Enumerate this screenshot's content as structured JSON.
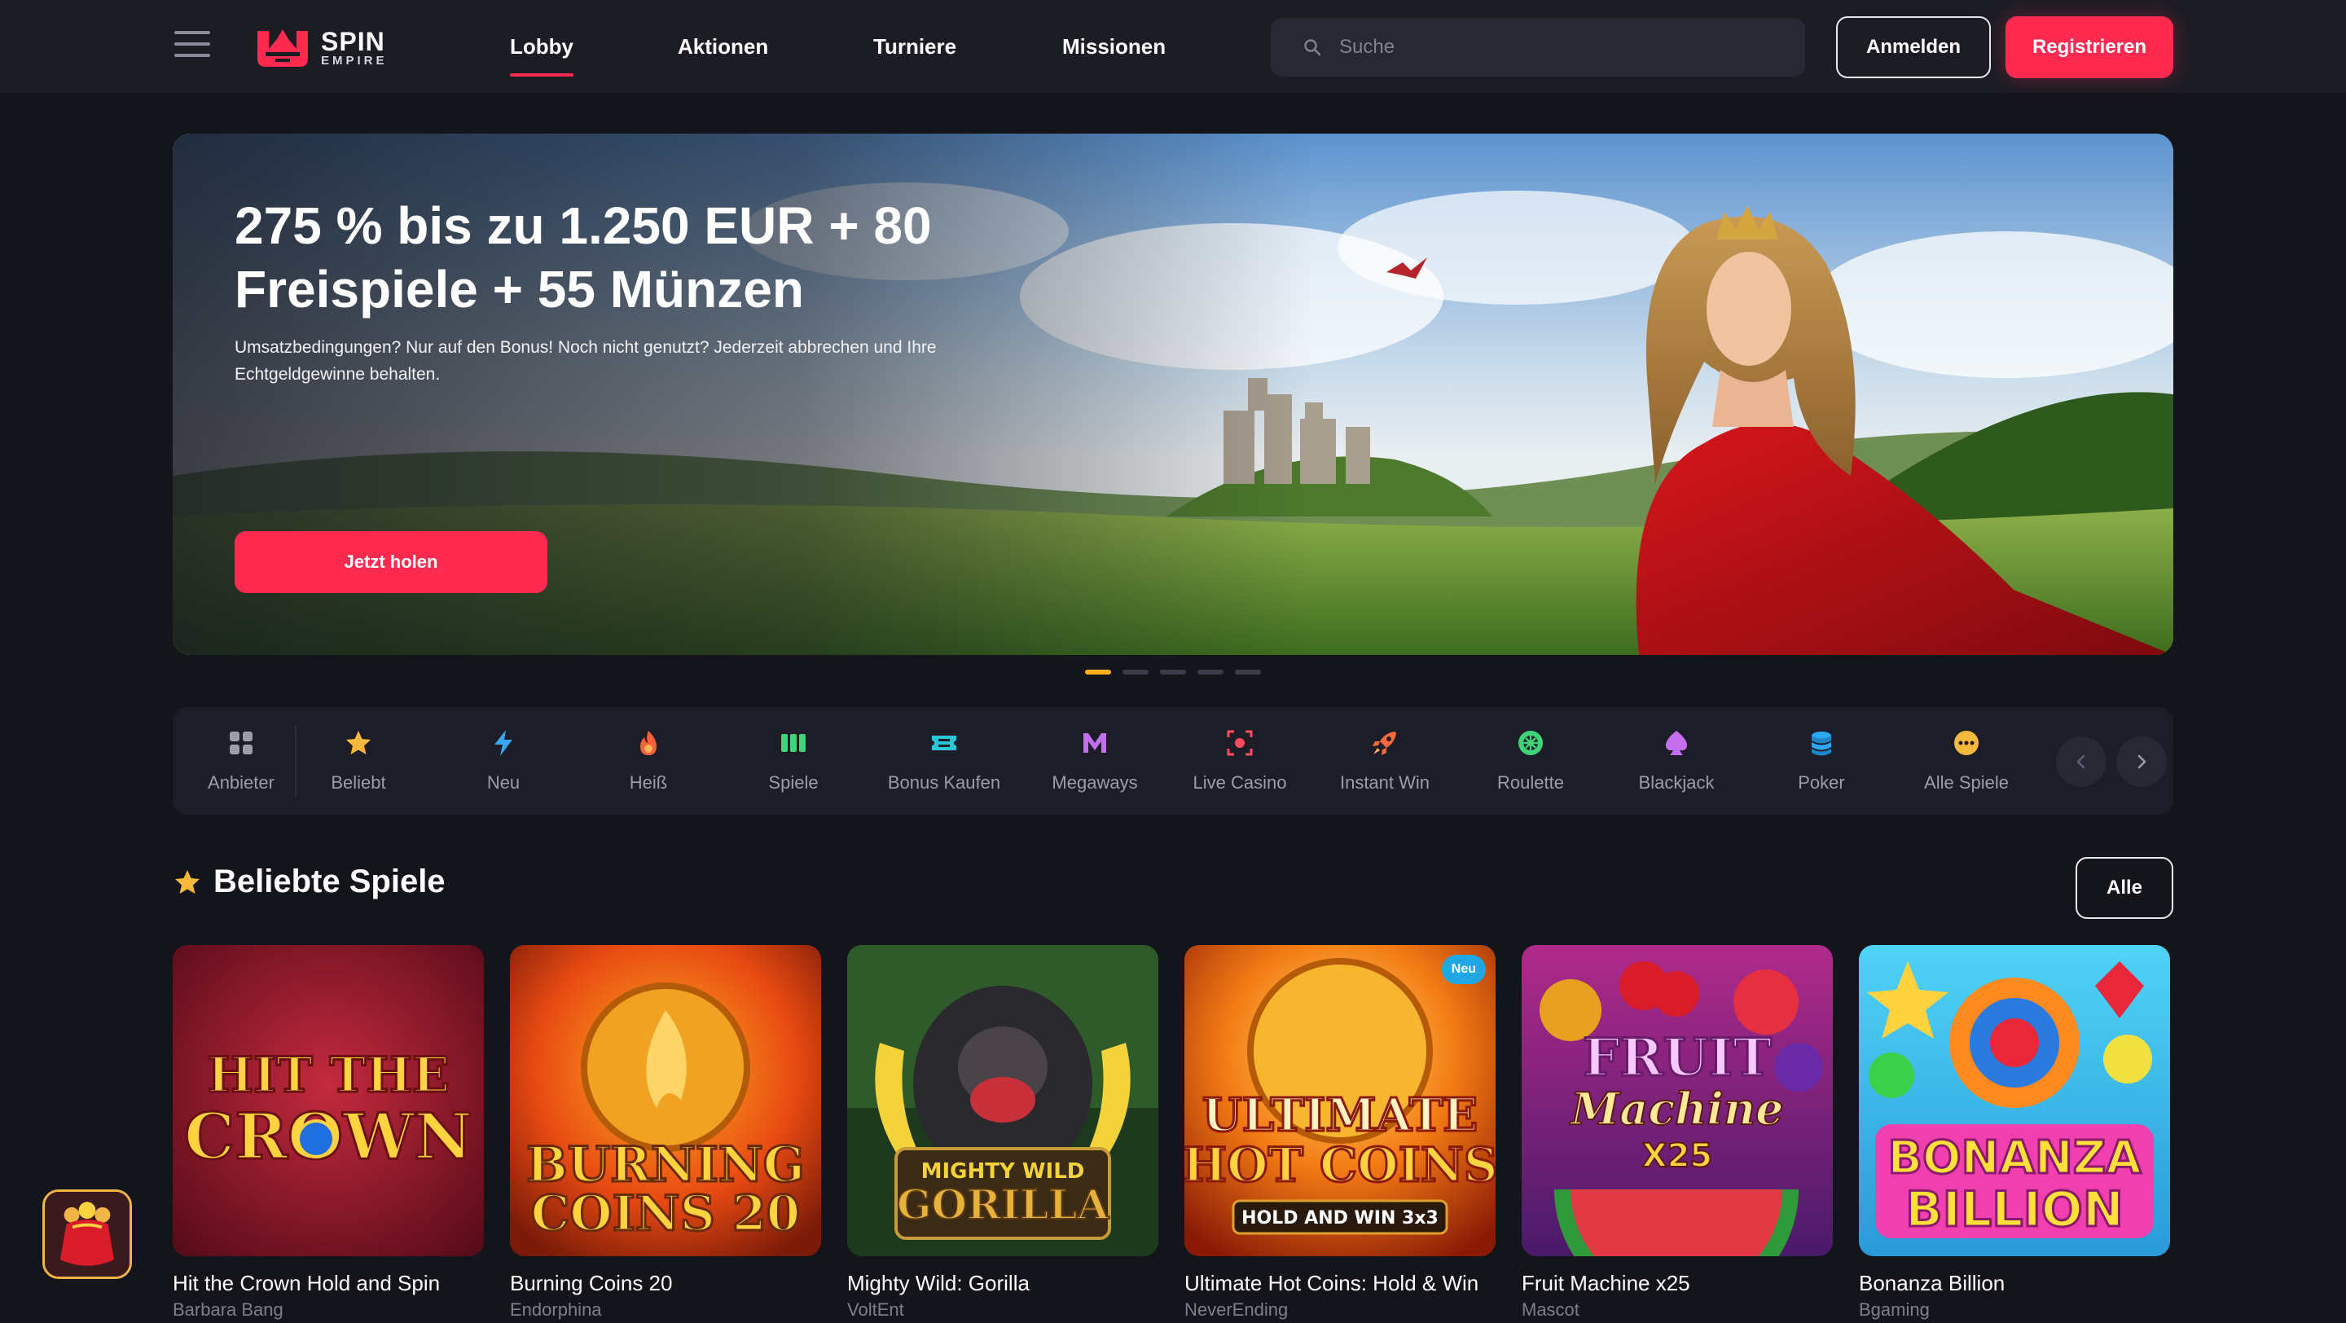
{
  "header": {
    "logo_line1": "SPIN",
    "logo_line2": "EMPIRE",
    "nav": [
      "Lobby",
      "Aktionen",
      "Turniere",
      "Missionen"
    ],
    "active_nav": "Lobby",
    "search_placeholder": "Suche",
    "login_label": "Anmelden",
    "register_label": "Registrieren"
  },
  "hero": {
    "title": "275 % bis zu 1.250 EUR + 80 Freispiele + 55 Münzen",
    "subtitle": "Umsatzbedingungen? Nur auf den Bonus! Noch nicht genutzt? Jederzeit abbrechen und Ihre Echtgeldgewinne behalten.",
    "cta_label": "Jetzt holen",
    "slide_count": 5,
    "active_slide": 1
  },
  "categories": [
    {
      "label": "Anbieter",
      "icon": "grid-icon"
    },
    {
      "label": "Beliebt",
      "icon": "star-icon"
    },
    {
      "label": "Neu",
      "icon": "lightning-icon"
    },
    {
      "label": "Heiß",
      "icon": "flame-icon"
    },
    {
      "label": "Spiele",
      "icon": "slots-icon"
    },
    {
      "label": "Bonus Kaufen",
      "icon": "ticket-icon"
    },
    {
      "label": "Megaways",
      "icon": "megaways-icon"
    },
    {
      "label": "Live Casino",
      "icon": "live-camera-icon"
    },
    {
      "label": "Instant Win",
      "icon": "rocket-icon"
    },
    {
      "label": "Roulette",
      "icon": "roulette-icon"
    },
    {
      "label": "Blackjack",
      "icon": "spade-icon"
    },
    {
      "label": "Poker",
      "icon": "chips-icon"
    },
    {
      "label": "Alle Spiele",
      "icon": "ellipsis-icon"
    }
  ],
  "section": {
    "title": "Beliebte Spiele",
    "all_label": "Alle"
  },
  "games": [
    {
      "name": "Hit the Crown Hold and Spin",
      "provider": "Barbara Bang",
      "art": "HIT THE CROWN"
    },
    {
      "name": "Burning Coins 20",
      "provider": "Endorphina",
      "art": "BURNING COINS 20"
    },
    {
      "name": "Mighty Wild: Gorilla",
      "provider": "VoltEnt",
      "art": "MIGHTY WILD GORILLA"
    },
    {
      "name": "Ultimate Hot Coins: Hold & Win",
      "provider": "NeverEnding",
      "art": "ULTIMATE HOT COINS",
      "badge": "Neu"
    },
    {
      "name": "Fruit Machine x25",
      "provider": "Mascot",
      "art": "FRUIT Machine X25"
    },
    {
      "name": "Bonanza Billion",
      "provider": "Bgaming",
      "art": "BONANZA BILLION"
    }
  ],
  "colors": {
    "accent": "#ff2a4f",
    "background": "#14151b",
    "header": "#1b1c24",
    "dot_active": "#ffb020"
  }
}
